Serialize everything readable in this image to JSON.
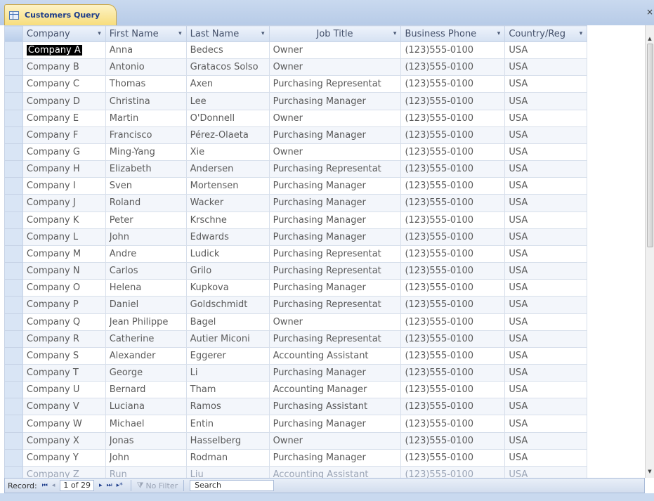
{
  "window": {
    "tab_title": "Customers Query",
    "close_glyph": "×"
  },
  "columns": [
    {
      "label": "Company",
      "arrow": "▾"
    },
    {
      "label": "First Name",
      "arrow": "▾"
    },
    {
      "label": "Last Name",
      "arrow": "▾"
    },
    {
      "label": "Job Title",
      "arrow": "▾"
    },
    {
      "label": "Business Phone",
      "arrow": "▾"
    },
    {
      "label": "Country/Reg",
      "arrow": "▾"
    }
  ],
  "rows": [
    [
      "Company A",
      "Anna",
      "Bedecs",
      "Owner",
      "(123)555-0100",
      "USA"
    ],
    [
      "Company B",
      "Antonio",
      "Gratacos Solso",
      "Owner",
      "(123)555-0100",
      "USA"
    ],
    [
      "Company C",
      "Thomas",
      "Axen",
      "Purchasing Representat",
      "(123)555-0100",
      "USA"
    ],
    [
      "Company D",
      "Christina",
      "Lee",
      "Purchasing Manager",
      "(123)555-0100",
      "USA"
    ],
    [
      "Company E",
      "Martin",
      "O'Donnell",
      "Owner",
      "(123)555-0100",
      "USA"
    ],
    [
      "Company F",
      "Francisco",
      "Pérez-Olaeta",
      "Purchasing Manager",
      "(123)555-0100",
      "USA"
    ],
    [
      "Company G",
      "Ming-Yang",
      "Xie",
      "Owner",
      "(123)555-0100",
      "USA"
    ],
    [
      "Company H",
      "Elizabeth",
      "Andersen",
      "Purchasing Representat",
      "(123)555-0100",
      "USA"
    ],
    [
      "Company I",
      "Sven",
      "Mortensen",
      "Purchasing Manager",
      "(123)555-0100",
      "USA"
    ],
    [
      "Company J",
      "Roland",
      "Wacker",
      "Purchasing Manager",
      "(123)555-0100",
      "USA"
    ],
    [
      "Company K",
      "Peter",
      "Krschne",
      "Purchasing Manager",
      "(123)555-0100",
      "USA"
    ],
    [
      "Company L",
      "John",
      "Edwards",
      "Purchasing Manager",
      "(123)555-0100",
      "USA"
    ],
    [
      "Company M",
      "Andre",
      "Ludick",
      "Purchasing Representat",
      "(123)555-0100",
      "USA"
    ],
    [
      "Company N",
      "Carlos",
      "Grilo",
      "Purchasing Representat",
      "(123)555-0100",
      "USA"
    ],
    [
      "Company O",
      "Helena",
      "Kupkova",
      "Purchasing Manager",
      "(123)555-0100",
      "USA"
    ],
    [
      "Company P",
      "Daniel",
      "Goldschmidt",
      "Purchasing Representat",
      "(123)555-0100",
      "USA"
    ],
    [
      "Company Q",
      "Jean Philippe",
      "Bagel",
      "Owner",
      "(123)555-0100",
      "USA"
    ],
    [
      "Company R",
      "Catherine",
      "Autier Miconi",
      "Purchasing Representat",
      "(123)555-0100",
      "USA"
    ],
    [
      "Company S",
      "Alexander",
      "Eggerer",
      "Accounting Assistant",
      "(123)555-0100",
      "USA"
    ],
    [
      "Company T",
      "George",
      "Li",
      "Purchasing Manager",
      "(123)555-0100",
      "USA"
    ],
    [
      "Company U",
      "Bernard",
      "Tham",
      "Accounting Manager",
      "(123)555-0100",
      "USA"
    ],
    [
      "Company V",
      "Luciana",
      "Ramos",
      "Purchasing Assistant",
      "(123)555-0100",
      "USA"
    ],
    [
      "Company W",
      "Michael",
      "Entin",
      "Purchasing Manager",
      "(123)555-0100",
      "USA"
    ],
    [
      "Company X",
      "Jonas",
      "Hasselberg",
      "Owner",
      "(123)555-0100",
      "USA"
    ],
    [
      "Company Y",
      "John",
      "Rodman",
      "Purchasing Manager",
      "(123)555-0100",
      "USA"
    ],
    [
      "Company Z",
      "Run",
      "Liu",
      "Accounting Assistant",
      "(123)555-0100",
      "USA"
    ]
  ],
  "navigation": {
    "record_label": "Record:",
    "first_glyph": "⏮",
    "prev_glyph": "◂",
    "position_text": "1 of 29",
    "next_glyph": "▸",
    "last_glyph": "⏭",
    "new_glyph": "▸*",
    "filter_label": "No Filter",
    "search_label": "Search"
  }
}
